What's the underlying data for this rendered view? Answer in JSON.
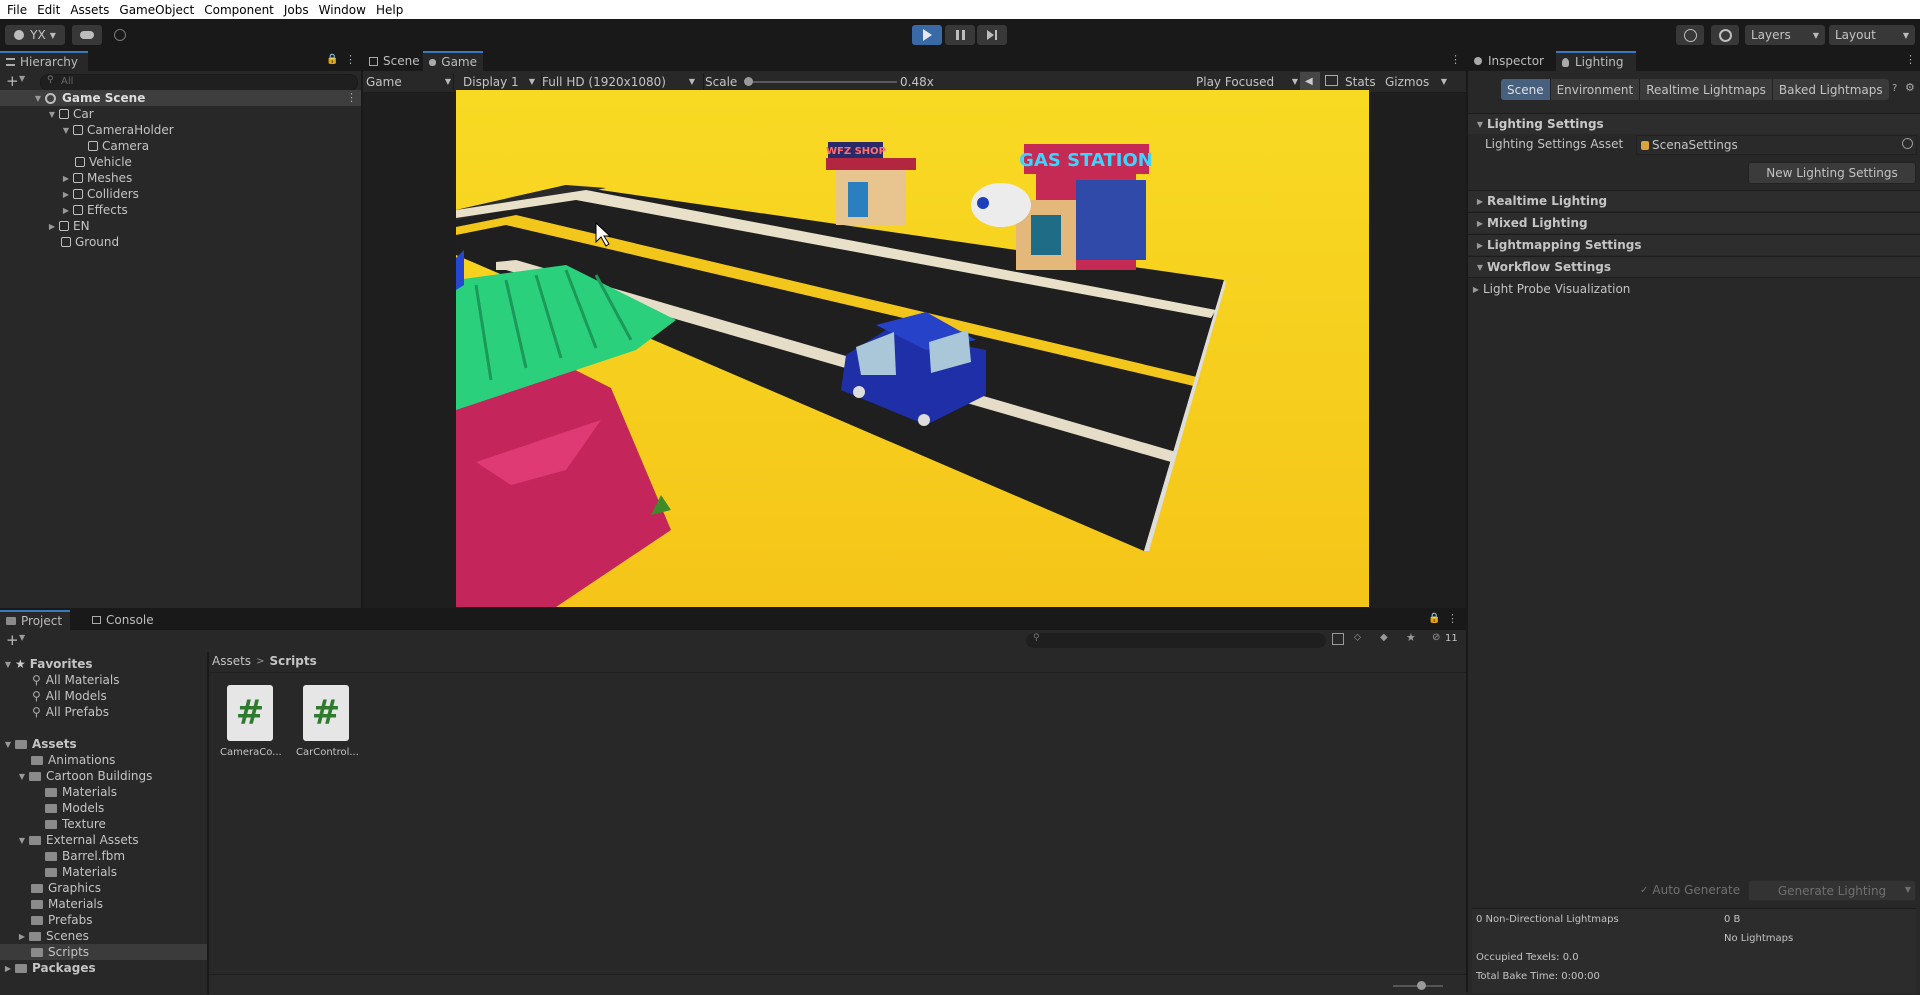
{
  "menubar": {
    "items": [
      "File",
      "Edit",
      "Assets",
      "GameObject",
      "Component",
      "Jobs",
      "Window",
      "Help"
    ]
  },
  "toolbar": {
    "account": "YX",
    "layers": "Layers",
    "layout": "Layout"
  },
  "hierarchy": {
    "tab": "Hierarchy",
    "search_placeholder": "All",
    "scene": "Game Scene",
    "items": [
      "Car",
      "CameraHolder",
      "Camera",
      "Vehicle",
      "Meshes",
      "Colliders",
      "Effects",
      "EN",
      "Ground"
    ]
  },
  "game_view": {
    "tabs": [
      "Scene",
      "Game"
    ],
    "game_dropdown": "Game",
    "display": "Display 1",
    "resolution": "Full HD (1920x1080)",
    "scale_label": "Scale",
    "scale_value": "0.48x",
    "play_mode": "Play Focused",
    "stats": "Stats",
    "gizmos": "Gizmos",
    "sign_shop": "WFZ SHOP",
    "sign_gas": "GAS STATION"
  },
  "inspector": {
    "tabs": [
      "Inspector",
      "Lighting"
    ],
    "subtabs": [
      "Scene",
      "Environment",
      "Realtime Lightmaps",
      "Baked Lightmaps"
    ],
    "lighting_settings": "Lighting Settings",
    "asset_label": "Lighting Settings Asset",
    "asset_value": "ScenaSettings",
    "new_button": "New Lighting Settings",
    "sections": [
      "Realtime Lighting",
      "Mixed Lighting",
      "Lightmapping Settings",
      "Workflow Settings",
      "Light Probe Visualization"
    ],
    "auto_generate": "Auto Generate",
    "generate": "Generate Lighting",
    "stat_lightmaps": "0 Non-Directional Lightmaps",
    "stat_size": "0 B",
    "stat_none": "No Lightmaps",
    "stat_texels": "Occupied Texels: 0.0",
    "stat_bake": "Total Bake Time: 0:00:00"
  },
  "project": {
    "tabs": [
      "Project",
      "Console"
    ],
    "count": "11",
    "favorites": "Favorites",
    "fav_items": [
      "All Materials",
      "All Models",
      "All Prefabs"
    ],
    "assets": "Assets",
    "tree": [
      "Animations",
      "Cartoon Buildings",
      "Materials",
      "Models",
      "Texture",
      "External Assets",
      "Barrel.fbm",
      "Materials",
      "Graphics",
      "Materials",
      "Prefabs",
      "Scenes",
      "Scripts"
    ],
    "packages": "Packages",
    "breadcrumb": [
      "Assets",
      "Scripts"
    ],
    "files": [
      "CameraCo...",
      "CarControl..."
    ],
    "file_glyph": "#"
  },
  "colors": {
    "accent": "#3a79bb",
    "panel": "#282828",
    "dark": "#191919",
    "sky": "#f7c81b"
  }
}
